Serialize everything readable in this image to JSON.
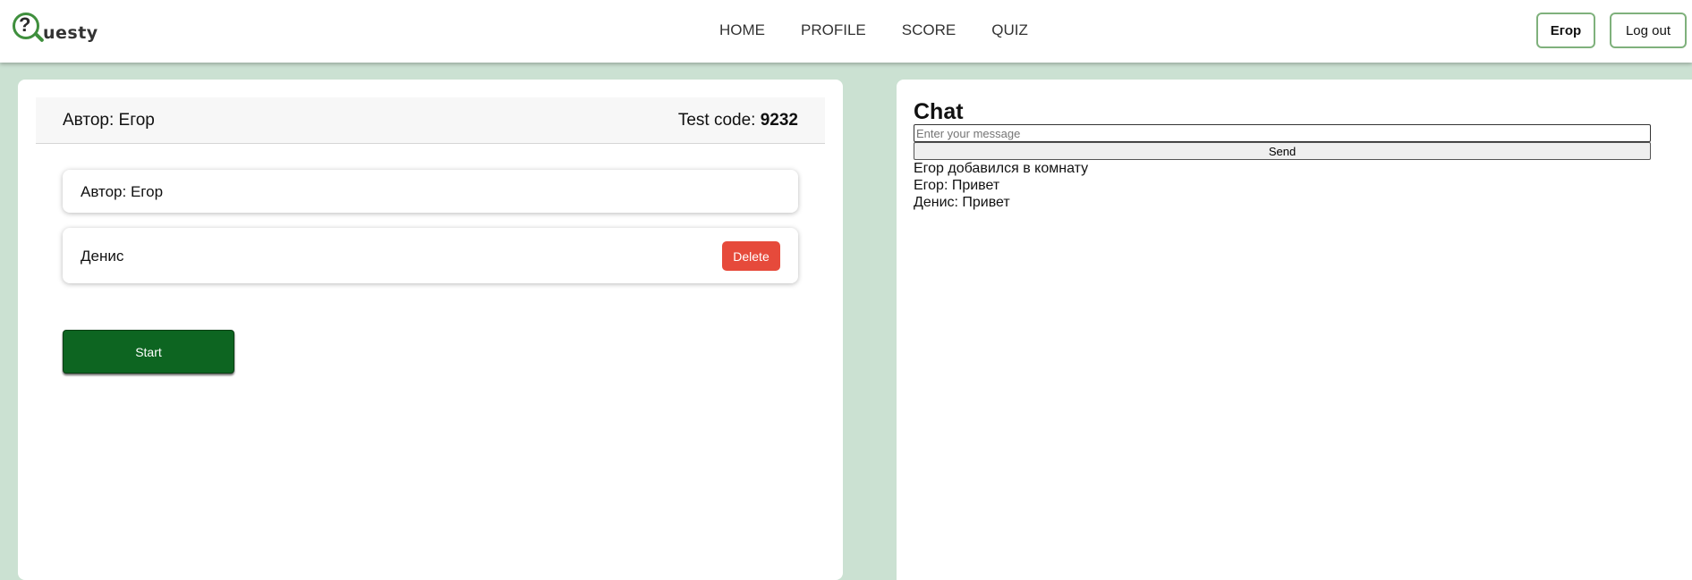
{
  "header": {
    "logo_text": "uesty",
    "logo_q": "?",
    "nav": [
      {
        "label": "HOME"
      },
      {
        "label": "PROFILE"
      },
      {
        "label": "SCORE"
      },
      {
        "label": "QUIZ"
      }
    ],
    "user_label": "Егор",
    "logout_label": "Log out"
  },
  "room": {
    "author_title": "Автор: Егор",
    "test_code_label": "Test code:",
    "test_code_value": "9232",
    "participants": [
      {
        "name": "Автор: Егор"
      },
      {
        "name": "Денис",
        "action": "Delete"
      }
    ],
    "start_label": "Start"
  },
  "chat": {
    "title": "Chat",
    "input_placeholder": "Enter your message",
    "send_label": "Send",
    "messages": [
      "Егор добавился в комнату",
      "Егор: Привет",
      "Денис: Привет"
    ]
  },
  "colors": {
    "background": "#cbe1d2",
    "brand_green": "#3f8f3d",
    "start_green": "#0d6521",
    "delete_red": "#e64a3b"
  }
}
